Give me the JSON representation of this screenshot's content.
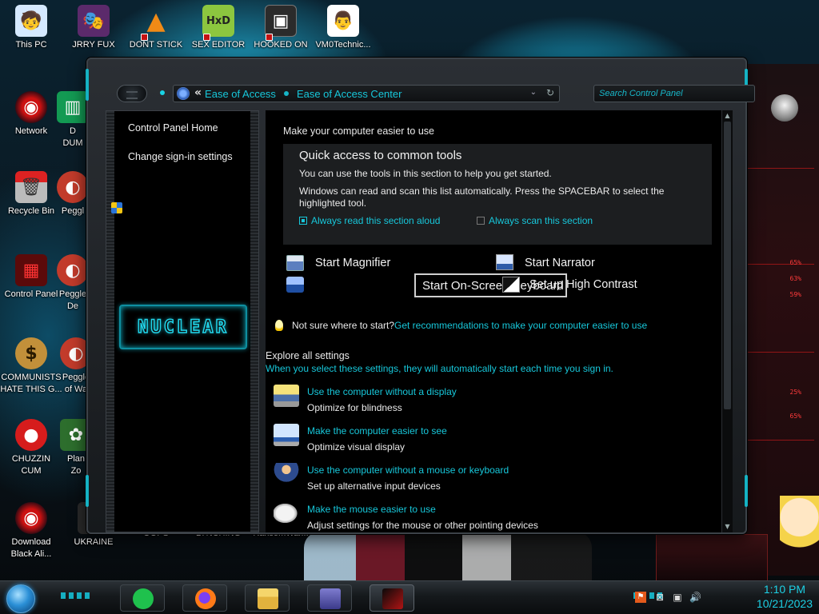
{
  "desktop": {
    "icons": [
      {
        "label": "This PC",
        "glyph": "🧒",
        "bg": "#d5e9ff"
      },
      {
        "label": "JRRY FUX",
        "glyph": "🎭",
        "bg": "#5b2a6b"
      },
      {
        "label": "DONT STICK",
        "glyph": "▲",
        "bg": "#f08a16"
      },
      {
        "label": "SEX EDITOR",
        "glyph": "HxD",
        "bg": "#8cc63f"
      },
      {
        "label": "HOOKED ON",
        "glyph": "▣",
        "bg": "#2b2b2b"
      },
      {
        "label": "VM0Technic...",
        "glyph": "👨",
        "bg": "#ffffff"
      },
      {
        "label": "Network",
        "glyph": "◉",
        "bg": "#3a0a12"
      },
      {
        "label": "D\nDUM",
        "glyph": "▥",
        "bg": "#139a53"
      },
      {
        "label": "Recycle Bin",
        "glyph": "🗑",
        "bg": "#9a1a1a"
      },
      {
        "label": "Peggl",
        "glyph": "◐",
        "bg": "#c23b2b"
      },
      {
        "label": "Control Panel",
        "glyph": "▦",
        "bg": "#5b0a0a"
      },
      {
        "label": "Peggle\nDe",
        "glyph": "◐",
        "bg": "#c23b2b"
      },
      {
        "label": "COMMUNISTS\nHATE THIS G...",
        "glyph": "$",
        "bg": "#c2903a"
      },
      {
        "label": "Peggle\nof Wa",
        "glyph": "◐",
        "bg": "#c23b2b"
      },
      {
        "label": "CHUZZIN\nCUM",
        "glyph": "●",
        "bg": "#d61c1c"
      },
      {
        "label": "Plan\nZo",
        "glyph": "✿",
        "bg": "#2d6e2d"
      },
      {
        "label": "Download\nBlack Ali...",
        "glyph": "◉",
        "bg": "#3a0a12"
      },
      {
        "label": "UKRAINE",
        "glyph": "▤",
        "bg": "#2a2a2a"
      },
      {
        "label": "OOPS",
        "glyph": "",
        "bg": "transparent"
      },
      {
        "label": "LYNCHING",
        "glyph": "",
        "bg": "transparent"
      },
      {
        "label": "RansomWar...",
        "glyph": "",
        "bg": "transparent"
      }
    ],
    "gauges": [
      "65%",
      "63%",
      "59%",
      "25%",
      "65%"
    ]
  },
  "window": {
    "breadcrumb": {
      "chevron": "«",
      "crumb1": "Ease of Access",
      "crumb2": "Ease of Access Center"
    },
    "search_placeholder": "Search Control Panel",
    "left_pane": {
      "home": "Control Panel Home",
      "signin": "Change sign-in settings",
      "logo_text": "NUCLEAR"
    },
    "content": {
      "heading": "Make your computer easier to use",
      "quick": {
        "title": "Quick access to common tools",
        "line1": "You can use the tools in this section to help you get started.",
        "line2": "Windows can read and scan this list automatically.  Press the SPACEBAR to select the",
        "line3": "highlighted tool.",
        "read_aloud": "Always read this section aloud",
        "scan": "Always scan this section"
      },
      "tools": {
        "magnifier": "Start Magnifier",
        "narrator": "Start Narrator",
        "osk": "Start On-Screen Keyboard",
        "contrast": "Set up High Contrast"
      },
      "tip": {
        "text": "Not sure where to start?",
        "link": "Get recommendations to make your computer easier to use"
      },
      "explore": {
        "title": "Explore all settings",
        "subtitle": "When you select these settings, they will automatically start each time you sign in."
      },
      "settings": [
        {
          "link": "Use the computer without a display",
          "desc": "Optimize for blindness"
        },
        {
          "link": "Make the computer easier to see",
          "desc": "Optimize visual display"
        },
        {
          "link": "Use the computer without a mouse or keyboard",
          "desc": "Set up alternative input devices"
        },
        {
          "link": "Make the mouse easier to use",
          "desc": "Adjust settings for the mouse or other pointing devices"
        }
      ]
    }
  },
  "taskbar": {
    "time": "1:10 PM",
    "date": "10/21/2023"
  },
  "colors": {
    "accent": "#17c7da",
    "link": "#17c7da",
    "clock": "#1dd0e4"
  }
}
